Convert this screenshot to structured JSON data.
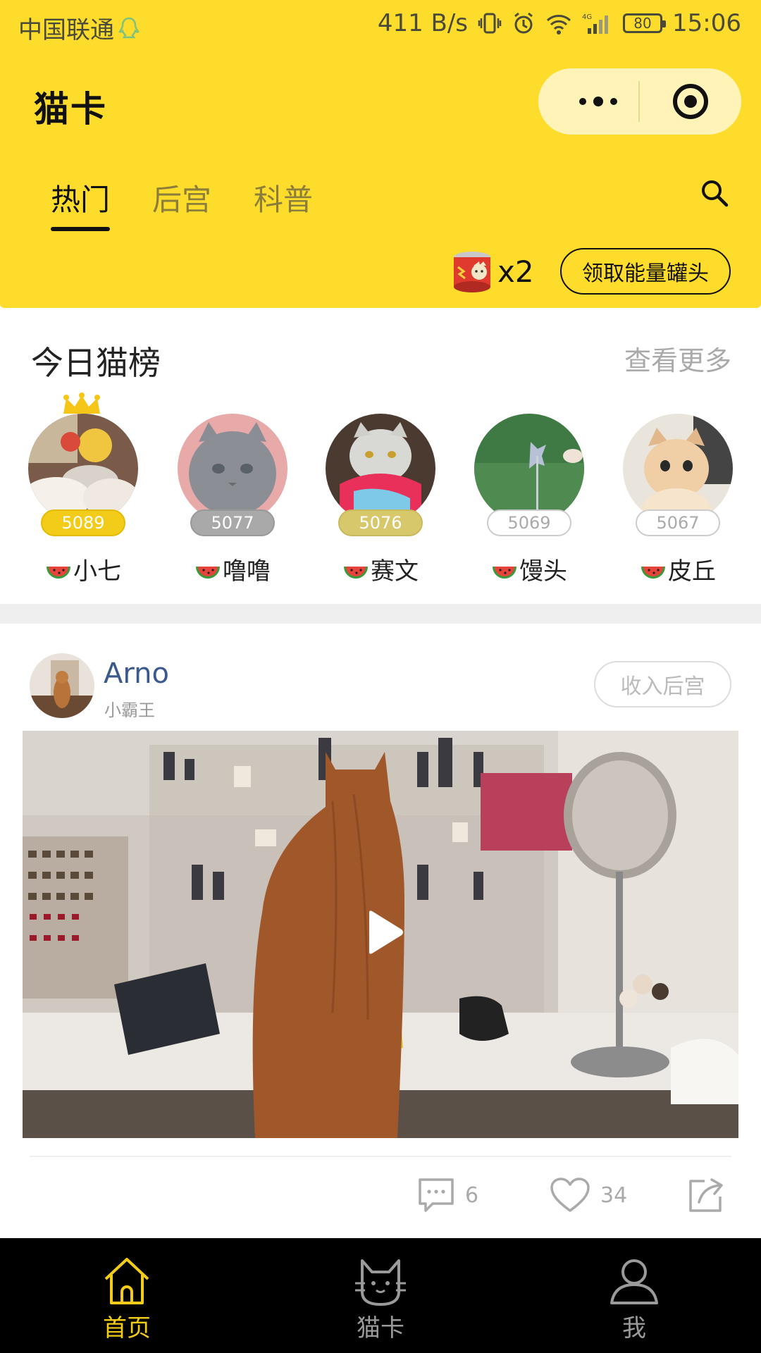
{
  "status_bar": {
    "carrier": "中国联通",
    "network_speed": "411 B/s",
    "battery_level": "80",
    "time": "15:06"
  },
  "header": {
    "title": "猫卡",
    "tabs": [
      {
        "label": "热门",
        "active": true
      },
      {
        "label": "后宫",
        "active": false
      },
      {
        "label": "科普",
        "active": false
      }
    ],
    "energy_can_count": "x2",
    "claim_button_label": "领取能量罐头"
  },
  "ranking": {
    "title": "今日猫榜",
    "more_label": "查看更多",
    "items": [
      {
        "name": "小七",
        "score": "5089",
        "badge": "gold"
      },
      {
        "name": "噜噜",
        "score": "5077",
        "badge": "silver"
      },
      {
        "name": "赛文",
        "score": "5076",
        "badge": "bronze"
      },
      {
        "name": "馒头",
        "score": "5069",
        "badge": "plain"
      },
      {
        "name": "皮丘",
        "score": "5067",
        "badge": "plain"
      }
    ]
  },
  "post": {
    "username": "Arno",
    "subtitle": "小霸王",
    "harem_button_label": "收入后宫",
    "comment_count": "6",
    "like_count": "34"
  },
  "tabbar": {
    "items": [
      {
        "label": "首页",
        "icon": "home-icon",
        "active": true
      },
      {
        "label": "猫卡",
        "icon": "cat-icon",
        "active": false
      },
      {
        "label": "我",
        "icon": "user-icon",
        "active": false
      }
    ]
  },
  "colors": {
    "brand_yellow": "#FEDC2C",
    "active_tab_yellow": "#F2CC18",
    "username_blue": "#3a5a8e"
  }
}
